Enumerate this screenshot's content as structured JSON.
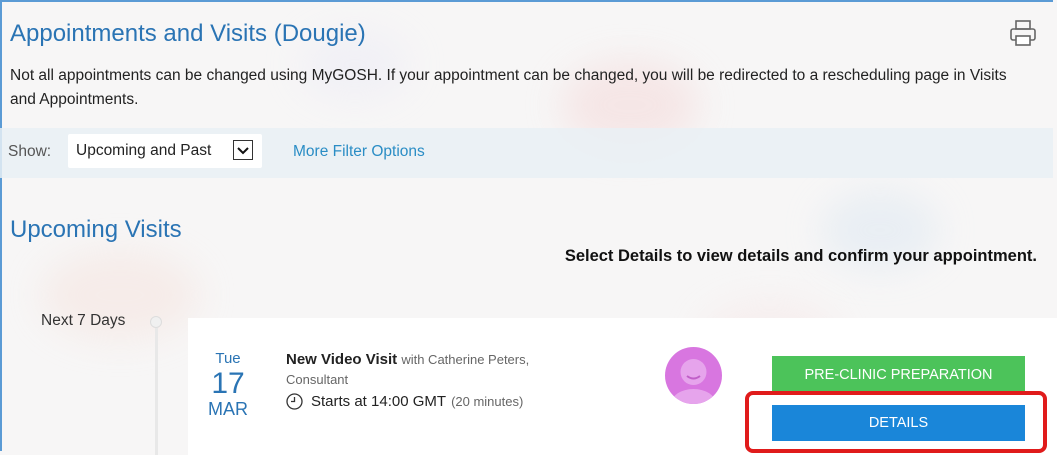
{
  "page": {
    "title": "Appointments and Visits (Dougie)",
    "intro": "Not all appointments can be changed using MyGOSH. If your appointment can be changed, you will be redirected to a rescheduling page in Visits and Appointments.",
    "print_icon": "printer-icon"
  },
  "filter": {
    "show_label": "Show:",
    "selected": "Upcoming and Past",
    "more_options": "More Filter Options"
  },
  "upcoming": {
    "heading": "Upcoming Visits",
    "instruction": "Select Details to view details and confirm your appointment.",
    "group_label": "Next 7 Days",
    "visit": {
      "day_of_week": "Tue",
      "day": "17",
      "month": "MAR",
      "type": "New Video Visit",
      "with_text": "with Catherine Peters,",
      "role": "Consultant",
      "clock_icon": "clock-icon",
      "starts": "Starts at 14:00 GMT",
      "duration": "(20 minutes)",
      "pre_clinic_label": "PRE-CLINIC PREPARATION",
      "details_label": "DETAILS"
    }
  },
  "colors": {
    "heading_blue": "#2a74b4",
    "link_blue": "#2a8dc5",
    "green_button": "#4cc35a",
    "blue_button": "#1a86d9",
    "highlight_red": "#e01b1b",
    "avatar_pink": "#d876e0"
  }
}
